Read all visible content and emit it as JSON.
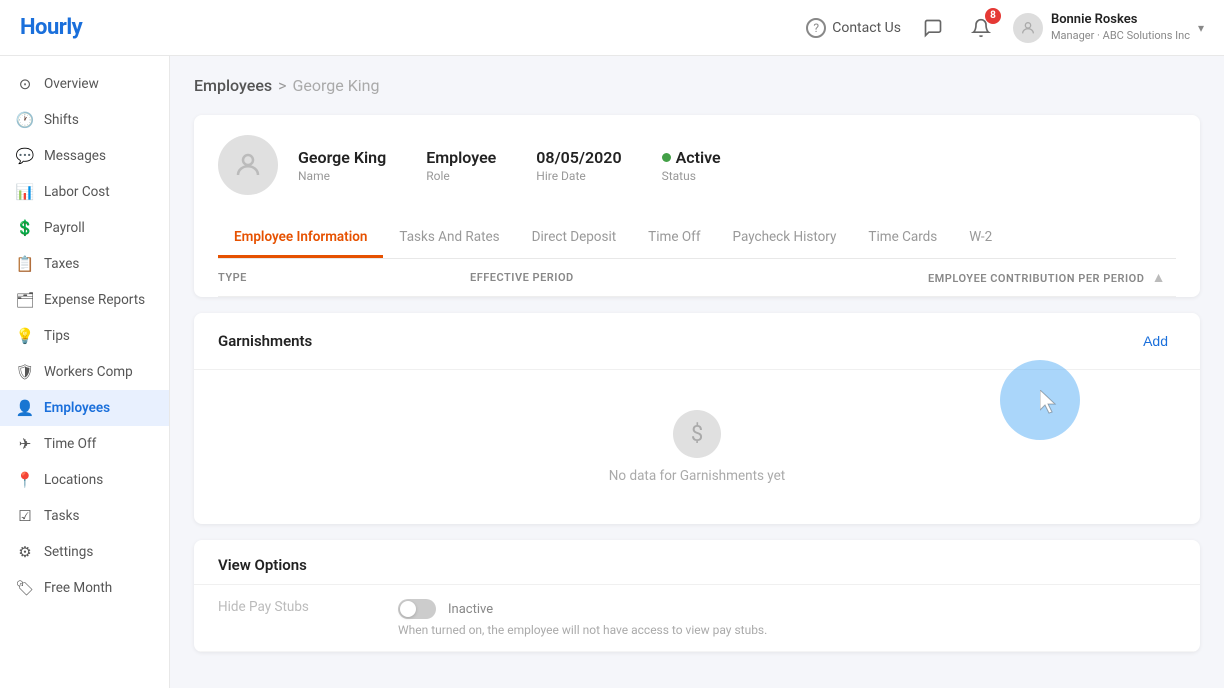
{
  "app": {
    "logo": "Hourly"
  },
  "header": {
    "contact_label": "Contact Us",
    "notification_count": "8",
    "user": {
      "name": "Bonnie Roskes",
      "company": "Manager · ABC Solutions Inc",
      "chevron": "▾"
    }
  },
  "sidebar": {
    "items": [
      {
        "id": "overview",
        "label": "Overview",
        "icon": "⊙"
      },
      {
        "id": "shifts",
        "label": "Shifts",
        "icon": "🕐"
      },
      {
        "id": "messages",
        "label": "Messages",
        "icon": "💬"
      },
      {
        "id": "labor-cost",
        "label": "Labor Cost",
        "icon": "📊"
      },
      {
        "id": "payroll",
        "label": "Payroll",
        "icon": "💲"
      },
      {
        "id": "taxes",
        "label": "Taxes",
        "icon": "📋"
      },
      {
        "id": "expense-reports",
        "label": "Expense Reports",
        "icon": "🗂"
      },
      {
        "id": "tips",
        "label": "Tips",
        "icon": "💡"
      },
      {
        "id": "workers-comp",
        "label": "Workers Comp",
        "icon": "🛡"
      },
      {
        "id": "employees",
        "label": "Employees",
        "icon": "👤"
      },
      {
        "id": "time-off",
        "label": "Time Off",
        "icon": "✈"
      },
      {
        "id": "locations",
        "label": "Locations",
        "icon": "📍"
      },
      {
        "id": "tasks",
        "label": "Tasks",
        "icon": "☑"
      },
      {
        "id": "settings",
        "label": "Settings",
        "icon": "⚙"
      },
      {
        "id": "free-month",
        "label": "Free Month",
        "icon": "🏷"
      }
    ]
  },
  "breadcrumb": {
    "parent": "Employees",
    "separator": ">",
    "current": "George King"
  },
  "employee": {
    "name": "George King",
    "name_label": "Name",
    "role": "Employee",
    "role_label": "Role",
    "hire_date": "08/05/2020",
    "hire_date_label": "Hire Date",
    "status": "Active",
    "status_label": "Status"
  },
  "tabs": [
    {
      "id": "employee-info",
      "label": "Employee Information",
      "active": true
    },
    {
      "id": "tasks-rates",
      "label": "Tasks And Rates",
      "active": false
    },
    {
      "id": "direct-deposit",
      "label": "Direct Deposit",
      "active": false
    },
    {
      "id": "time-off",
      "label": "Time Off",
      "active": false
    },
    {
      "id": "paycheck-history",
      "label": "Paycheck History",
      "active": false
    },
    {
      "id": "time-cards",
      "label": "Time Cards",
      "active": false
    },
    {
      "id": "w2",
      "label": "W-2",
      "active": false
    }
  ],
  "table": {
    "col_type": "TYPE",
    "col_period": "EFFECTIVE PERIOD",
    "col_contrib": "EMPLOYEE CONTRIBUTION PER PERIOD"
  },
  "garnishments": {
    "title": "Garnishments",
    "add_label": "Add",
    "empty_text": "No data for Garnishments yet"
  },
  "view_options": {
    "title": "View Options",
    "items": [
      {
        "label": "Hide Pay Stubs",
        "toggle_state": "Inactive",
        "description": "When turned on, the employee will not have access to view pay stubs."
      }
    ]
  }
}
